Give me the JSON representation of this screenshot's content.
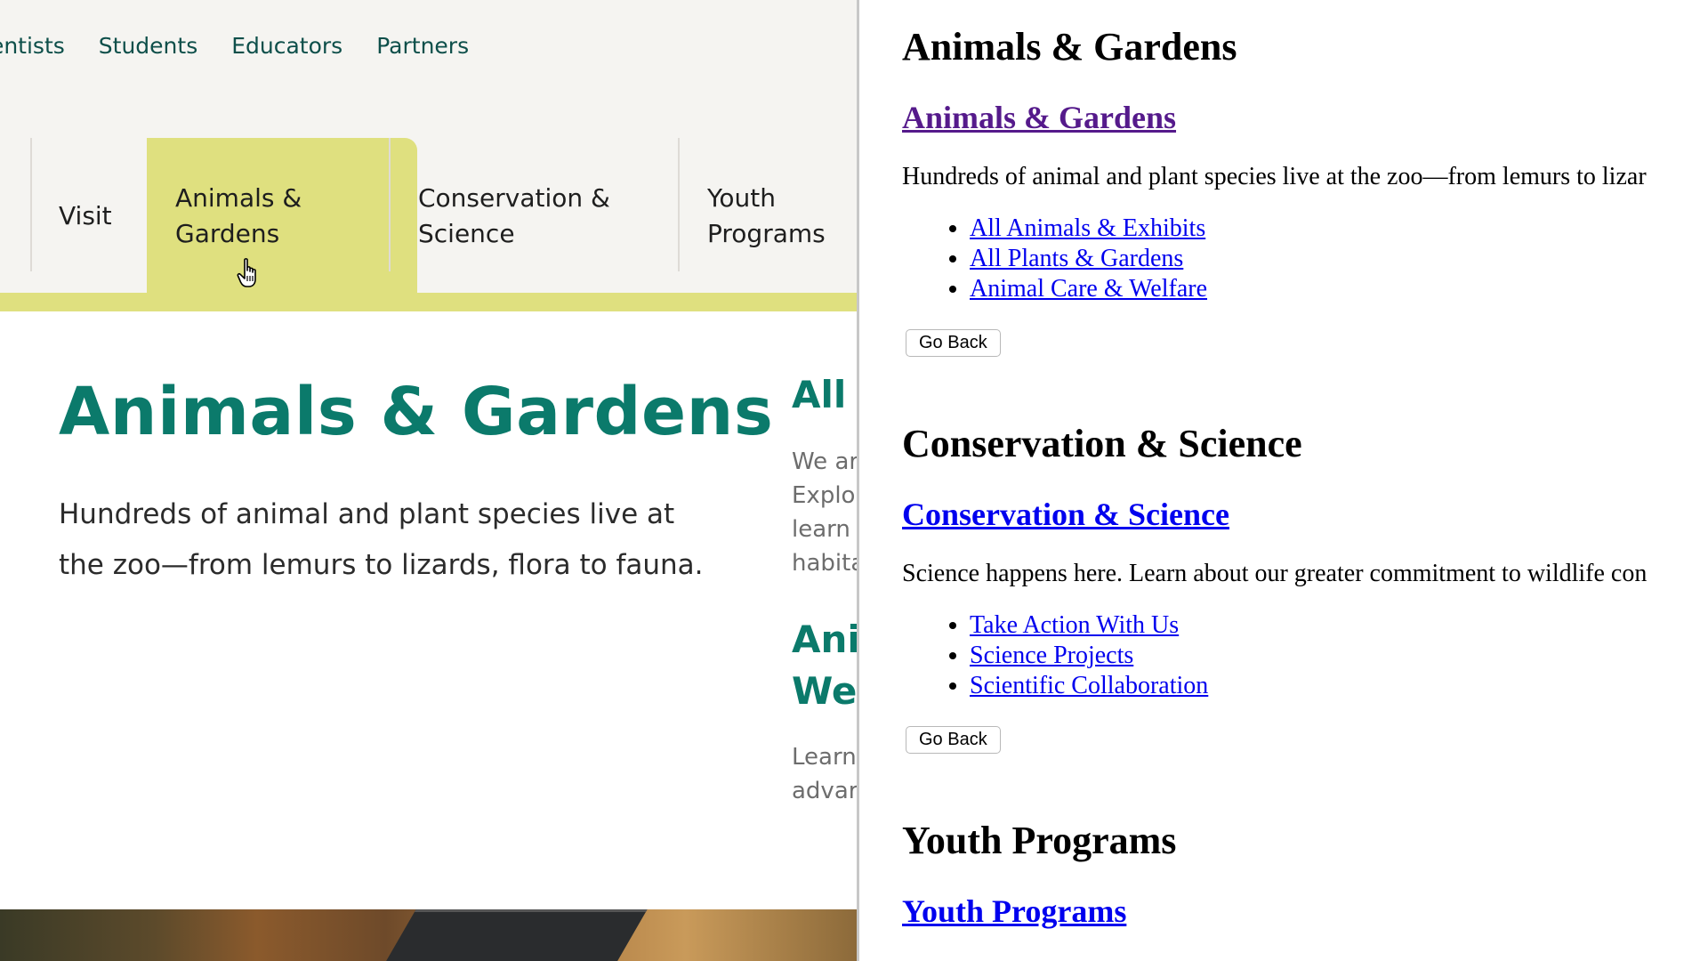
{
  "left": {
    "utility_nav": [
      "ientists",
      "Students",
      "Educators",
      "Partners"
    ],
    "main_nav": [
      {
        "label": "Visit",
        "active": false
      },
      {
        "label": "Animals &\nGardens",
        "active": true
      },
      {
        "label": "Conservation &\nScience",
        "active": false
      },
      {
        "label": "Youth\nPrograms",
        "active": false
      }
    ],
    "active_color": "#dfe07f",
    "heading": "Animals & Gardens",
    "heading_color": "#0b7a6b",
    "intro": "Hundreds of animal and plant species live at the zoo—from lemurs to lizards, flora to fauna.",
    "cards": [
      {
        "title": "All",
        "text": "We ar\nExplo\nlearn\nhabita"
      },
      {
        "title": "Ani\nWe",
        "text": "Learn\nadvar"
      }
    ]
  },
  "right": {
    "sections": [
      {
        "heading": "Animals & Gardens",
        "link": "Animals & Gardens",
        "link_visited": true,
        "description": "Hundreds of animal and plant species live at the zoo—from lemurs to lizar",
        "items": [
          "All Animals & Exhibits",
          "All Plants & Gardens",
          "Animal Care & Welfare"
        ],
        "button": "Go Back"
      },
      {
        "heading": "Conservation & Science",
        "link": "Conservation & Science",
        "link_visited": false,
        "description": "Science happens here. Learn about our greater commitment to wildlife con",
        "items": [
          "Take Action With Us",
          "Science Projects",
          "Scientific Collaboration"
        ],
        "button": "Go Back"
      },
      {
        "heading": "Youth Programs",
        "link": "Youth Programs",
        "link_visited": false
      }
    ],
    "visited_link_color": "#551a8b",
    "link_color": "#0000ee"
  }
}
